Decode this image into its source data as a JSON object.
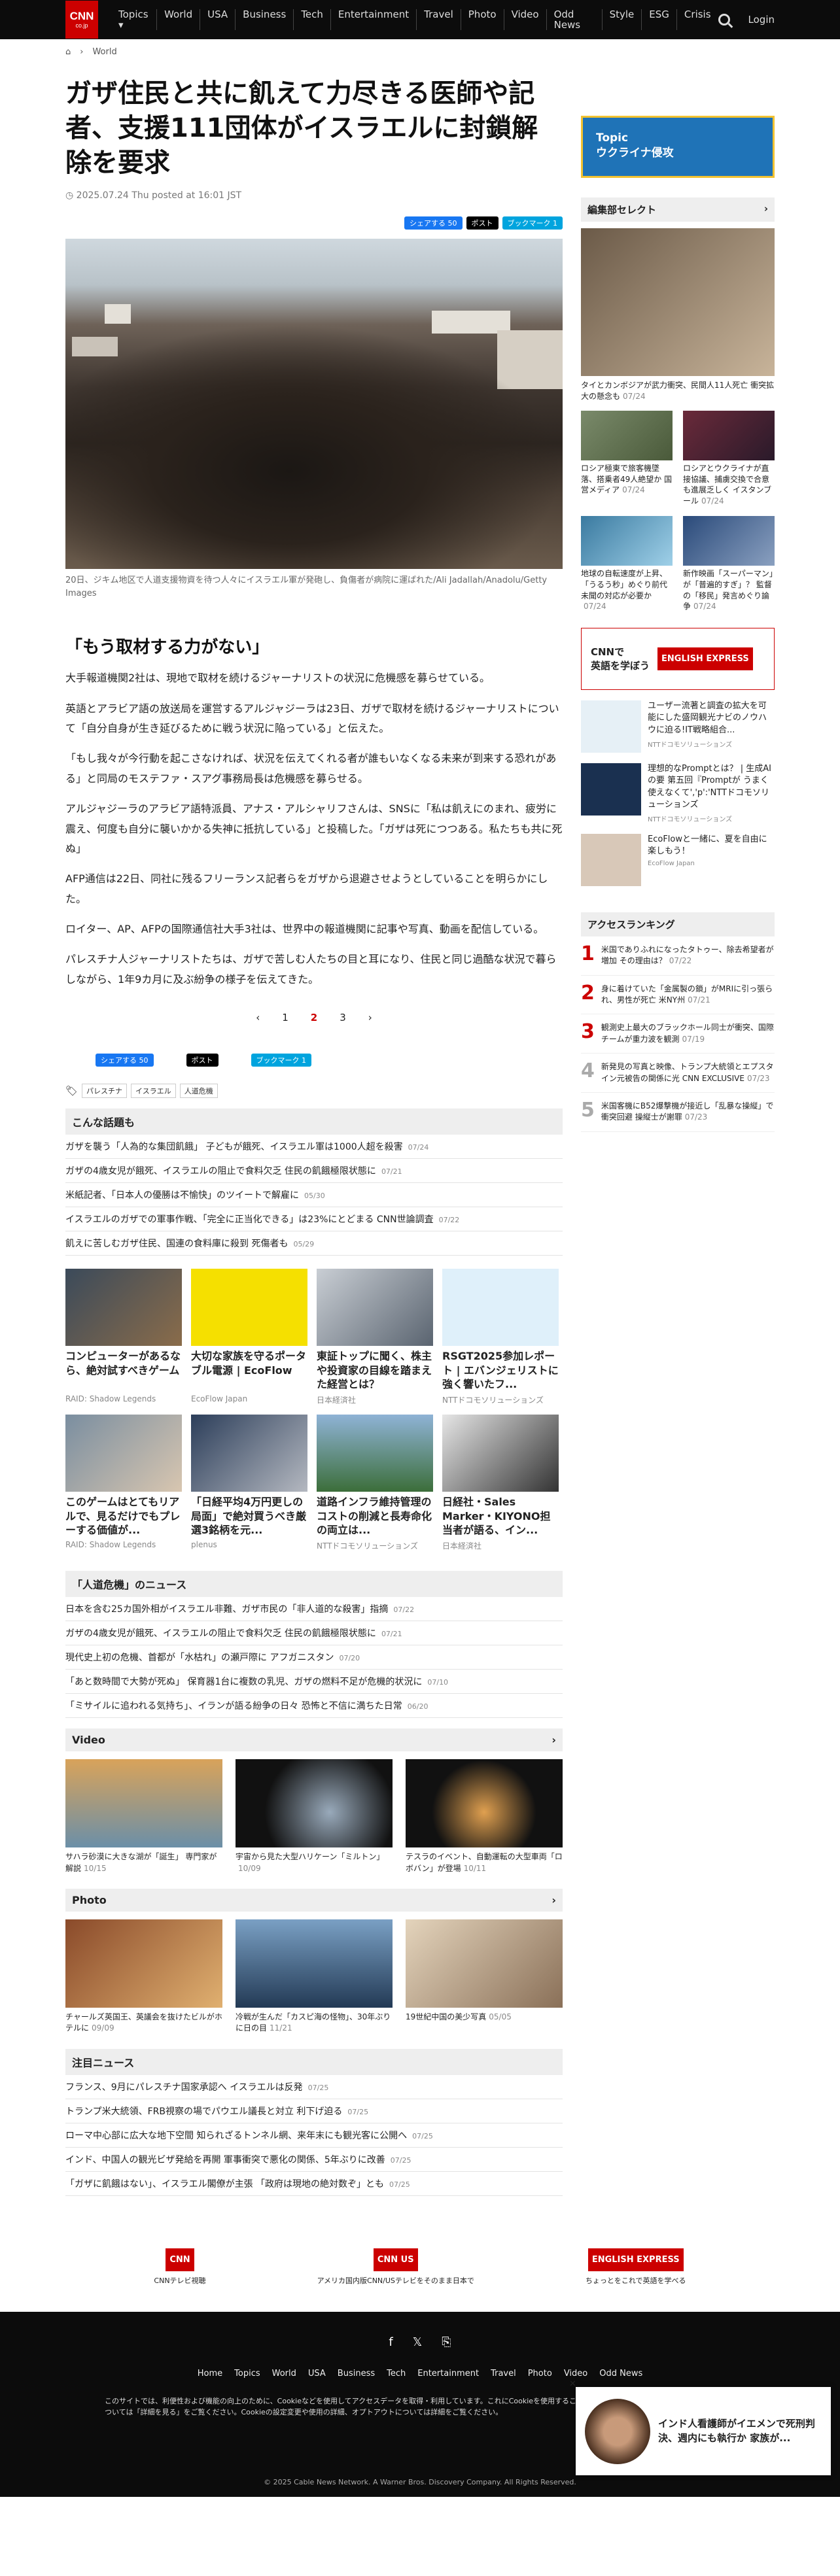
{
  "header": {
    "logo": "CNN",
    "logo_sub": "co.jp",
    "nav": [
      "Topics ▾",
      "World",
      "USA",
      "Business",
      "Tech",
      "Entertainment",
      "Travel",
      "Photo",
      "Video",
      "Odd News",
      "Style",
      "ESG",
      "Crisis"
    ],
    "login": "Login"
  },
  "breadcrumb": {
    "section": "World"
  },
  "article": {
    "title": "ガザ住民と共に飢えて力尽きる医師や記者、支援111団体がイスラエルに封鎖解除を要求",
    "date": "2025.07.24 Thu posted at 16:01 JST",
    "share": {
      "facebook": "シェアする 50",
      "x": "ポスト",
      "hatena": "ブックマーク 1"
    },
    "caption": "20日、ジキム地区で人道支援物資を待つ人々にイスラエル軍が発砲し、負傷者が病院に運ばれた/Ali Jadallah/Anadolu/Getty Images",
    "subhead": "「もう取材する力がない」",
    "paragraphs": [
      "大手報道機関2社は、現地で取材を続けるジャーナリストの状況に危機感を募らせている。",
      "英語とアラビア語の放送局を運営するアルジャジーラは23日、ガザで取材を続けるジャーナリストについて「自分自身が生き延びるために戦う状況に陥っている」と伝えた。",
      "「もし我々が今行動を起こさなければ、状況を伝えてくれる者が誰もいなくなる未来が到来する恐れがある」と同局のモステファ・スアグ事務局長は危機感を募らせる。",
      "アルジャジーラのアラビア語特派員、アナス・アルシャリフさんは、SNSに「私は飢えにのまれ、疲労に震え、何度も自分に襲いかかる失神に抵抗している」と投稿した。「ガザは死につつある。私たちも共に死ぬ」",
      "AFP通信は22日、同社に残るフリーランス記者らをガザから退避させようとしていることを明らかにした。",
      "ロイター、AP、AFPの国際通信社大手3社は、世界中の報道機関に記事や写真、動画を配信している。",
      "パレスチナ人ジャーナリストたちは、ガザで苦しむ人たちの目と耳になり、住民と同じ過酷な状況で暮らしながら、1年9カ月に及ぶ紛争の様子を伝えてきた。"
    ],
    "pager": [
      "‹",
      "1",
      "2",
      "3",
      "›"
    ],
    "share2": {
      "facebook": "シェアする 50",
      "x": "ポスト",
      "hatena": "ブックマーク 1"
    },
    "tags": [
      "パレスチナ",
      "イスラエル",
      "人道危機"
    ]
  },
  "related": {
    "title": "こんな話題も",
    "items": [
      {
        "t": "ガザを襲う「人為的な集団飢餓」 子どもが餓死、イスラエル軍は1000人超を殺害",
        "d": "07/24"
      },
      {
        "t": "ガザの4歳女児が餓死、イスラエルの阻止で食料欠乏 住民の飢餓極限状態に",
        "d": "07/21"
      },
      {
        "t": "米紙記者、「日本人の優勝は不愉快」のツイートで解雇に",
        "d": "05/30"
      },
      {
        "t": "イスラエルのガザでの軍事作戦、「完全に正当化できる」は23%にとどまる CNN世論調査",
        "d": "07/22"
      },
      {
        "t": "飢えに苦しむガザ住民、国連の食料庫に殺到 死傷者も",
        "d": "05/29"
      }
    ]
  },
  "promos": [
    {
      "t": "コンピューターがあるなら、絶対試すべきゲーム",
      "s": "RAID: Shadow Legends"
    },
    {
      "t": "大切な家族を守るポータブル電源 | EcoFlow",
      "s": "EcoFlow Japan"
    },
    {
      "t": "東証トップに聞く、株主や投資家の目線を踏まえた経営とは？",
      "s": "日本経済社"
    },
    {
      "t": "RSGT2025参加レポート | エバンジェリストに強く響いたフ...",
      "s": "NTTドコモソリューションズ"
    },
    {
      "t": "このゲームはとてもリアルで、見るだけでもプレーする価値が...",
      "s": "RAID: Shadow Legends"
    },
    {
      "t": "「日経平均4万円更しの局面」で絶対買うべき厳選3銘柄を元...",
      "s": "plenus"
    },
    {
      "t": "道路インフラ維持管理のコストの削減と長寿命化の両立は...",
      "s": "NTTドコモソリューションズ"
    },
    {
      "t": "日経社・Sales Marker・KIYONO担当者が語る、イン...",
      "s": "日本経済社"
    }
  ],
  "crisis": {
    "title": "「人道危機」のニュース",
    "items": [
      {
        "t": "日本を含む25カ国外相がイスラエル非難、ガザ市民の「非人道的な殺害」指摘",
        "d": "07/22"
      },
      {
        "t": "ガザの4歳女児が餓死、イスラエルの阻止で食料欠乏 住民の飢餓極限状態に",
        "d": "07/21"
      },
      {
        "t": "現代史上初の危機、首都が「水枯れ」の瀬戸際に アフガニスタン",
        "d": "07/20"
      },
      {
        "t": "「あと数時間で大勢が死ぬ」 保育器1台に複数の乳児、ガザの燃料不足が危機的状況に",
        "d": "07/10"
      },
      {
        "t": "「ミサイルに追われる気持ち」、イランが語る紛争の日々 恐怖と不信に満ちた日常",
        "d": "06/20"
      }
    ]
  },
  "video": {
    "title": "Video",
    "items": [
      {
        "t": "サハラ砂漠に大きな湖が「誕生」 専門家が解説",
        "d": "10/15"
      },
      {
        "t": "宇宙から見た大型ハリケーン「ミルトン」",
        "d": "10/09"
      },
      {
        "t": "テスラのイベント、自動運転の大型車両「ロボバン」が登場",
        "d": "10/11"
      }
    ]
  },
  "photo": {
    "title": "Photo",
    "items": [
      {
        "t": "チャールズ英国王、英議会を抜けたビルがホテルに",
        "d": "09/09"
      },
      {
        "t": "冷戦が生んだ「カスピ海の怪物」、30年ぶりに日の目",
        "d": "11/21"
      },
      {
        "t": "19世紀中国の美少写真",
        "d": "05/05"
      }
    ]
  },
  "attention": {
    "title": "注目ニュース",
    "items": [
      {
        "t": "フランス、9月にパレスチナ国家承認へ イスラエルは反発",
        "d": "07/25"
      },
      {
        "t": "トランプ米大統領、FRB視察の場でパウエル議長と対立 利下げ迫る",
        "d": "07/25"
      },
      {
        "t": "ローマ中心部に広大な地下空間 知られざるトンネル網、来年末にも観光客に公開へ",
        "d": "07/25"
      },
      {
        "t": "インド、中国人の観光ビザ発給を再開 軍事衝突で悪化の関係、5年ぶりに改善",
        "d": "07/25"
      },
      {
        "t": "「ガザに飢餓はない」、イスラエル閣僚が主張 「政府は現地の絶対数ぞ」とも",
        "d": "07/25"
      }
    ]
  },
  "sidebar": {
    "topic": {
      "label": "Topic",
      "title": "ウクライナ侵攻"
    },
    "picks_title": "編集部セレクト",
    "big": {
      "t": "タイとカンボジアが武力衝突、民間人11人死亡 衝突拡大の懸念も",
      "d": "07/24"
    },
    "grid": [
      {
        "t": "ロシア極東で旅客機墜落、搭乗者49人絶望か 国営メディア",
        "d": "07/24"
      },
      {
        "t": "ロシアとウクライナが直接協議、捕虜交換で合意も進展乏しく イスタンブール",
        "d": "07/24"
      },
      {
        "t": "地球の自転速度が上昇、「うるう秒」めぐり前代未聞の対応が必要か",
        "d": "07/24"
      },
      {
        "t": "新作映画「スーパーマン」が「普遍的すぎ」？ 監督の「移民」発言めぐり論争",
        "d": "07/24"
      }
    ],
    "ad": {
      "l1": "CNNで",
      "l2": "英語を学ぼう",
      "brand": "ENGLISH EXPRESS"
    },
    "promos": [
      {
        "t": "ユーザー流著と調査の拡大を可能にした盛岡観光ナビのノウハウに迫る!IT戦略組合...",
        "p": "NTTドコモソリューションズ"
      },
      {
        "t": "理想的なPromptとは？ | 生成AIの要 第五回『Promptが うまく使えなくて','p':'NTTドコモソリューションズ",
        "p": "NTTドコモソリューションズ"
      },
      {
        "t": "EcoFlowと一緒に、夏を自由に楽しもう！",
        "p": "EcoFlow Japan"
      }
    ],
    "ranking_title": "アクセスランキング",
    "ranking": [
      {
        "n": "1",
        "t": "米国でありふれになったタトゥー、除去希望者が増加 その理由は？",
        "d": "07/22"
      },
      {
        "n": "2",
        "t": "身に着けていた「金属製の鎖」がMRIに引っ張られ、男性が死亡 米NY州",
        "d": "07/21"
      },
      {
        "n": "3",
        "t": "観測史上最大のブラックホール同士が衝突、国際チームが重力波を観測",
        "d": "07/19"
      },
      {
        "n": "4",
        "t": "新発見の写真と映像、トランプ大統領とエプスタイン元被告の関係に光 CNN EXCLUSIVE",
        "d": "07/23"
      },
      {
        "n": "5",
        "t": "米国客機にB52爆撃機が接近し「乱暴な操縦」で衝突回避 操縦士が謝罪",
        "d": "07/23"
      }
    ]
  },
  "bottom": [
    {
      "t": "CNNテレビ視聴"
    },
    {
      "t": "アメリカ国内版CNN/USテレビをそのまま日本で"
    },
    {
      "t": "ちょっとをこれで英語を学べる"
    }
  ],
  "footer": {
    "nav": [
      "Home",
      "Topics",
      "World",
      "USA",
      "Business",
      "Tech",
      "Entertainment",
      "Travel",
      "Photo",
      "Video",
      "Odd News"
    ],
    "cookie": "このサイトでは、利便性および機能の向上のために、Cookieなどを使用してアクセスデータを取得・利用しています。これにCookieを使用することに同意します。Cookieの設定や使用の詳細については「詳細を見る」をご覧ください。Cookieの設定変更や使用の詳細、オプトアウトについては詳細をご覧ください。",
    "copy": "© 2025 Cable News Network. A Warner Bros. Discovery Company. All Rights Reserved."
  },
  "popup": {
    "t": "インド人看護師がイエメンで死刑判決、週内にも執行か 家族が..."
  }
}
